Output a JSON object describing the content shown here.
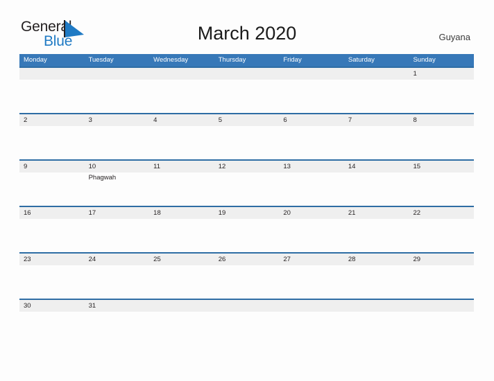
{
  "brand": {
    "name_part1": "General",
    "name_part2": "Blue",
    "color_dark": "#231f20",
    "color_blue": "#1f7ac4",
    "flag_icon": "blue-flag-triangle-icon"
  },
  "header": {
    "title": "March 2020",
    "country": "Guyana"
  },
  "theme": {
    "header_blue": "#3778b8",
    "divider_blue": "#2e6da4",
    "band_gray": "#efefef",
    "page_bg": "#fdfdfd",
    "text": "#231f20"
  },
  "calendar": {
    "month": "March",
    "year": "2020",
    "weekday_headers": [
      "Monday",
      "Tuesday",
      "Wednesday",
      "Thursday",
      "Friday",
      "Saturday",
      "Sunday"
    ],
    "weeks": [
      {
        "cells": [
          {
            "day": "",
            "event": ""
          },
          {
            "day": "",
            "event": ""
          },
          {
            "day": "",
            "event": ""
          },
          {
            "day": "",
            "event": ""
          },
          {
            "day": "",
            "event": ""
          },
          {
            "day": "",
            "event": ""
          },
          {
            "day": "1",
            "event": ""
          }
        ]
      },
      {
        "cells": [
          {
            "day": "2",
            "event": ""
          },
          {
            "day": "3",
            "event": ""
          },
          {
            "day": "4",
            "event": ""
          },
          {
            "day": "5",
            "event": ""
          },
          {
            "day": "6",
            "event": ""
          },
          {
            "day": "7",
            "event": ""
          },
          {
            "day": "8",
            "event": ""
          }
        ]
      },
      {
        "cells": [
          {
            "day": "9",
            "event": ""
          },
          {
            "day": "10",
            "event": "Phagwah"
          },
          {
            "day": "11",
            "event": ""
          },
          {
            "day": "12",
            "event": ""
          },
          {
            "day": "13",
            "event": ""
          },
          {
            "day": "14",
            "event": ""
          },
          {
            "day": "15",
            "event": ""
          }
        ]
      },
      {
        "cells": [
          {
            "day": "16",
            "event": ""
          },
          {
            "day": "17",
            "event": ""
          },
          {
            "day": "18",
            "event": ""
          },
          {
            "day": "19",
            "event": ""
          },
          {
            "day": "20",
            "event": ""
          },
          {
            "day": "21",
            "event": ""
          },
          {
            "day": "22",
            "event": ""
          }
        ]
      },
      {
        "cells": [
          {
            "day": "23",
            "event": ""
          },
          {
            "day": "24",
            "event": ""
          },
          {
            "day": "25",
            "event": ""
          },
          {
            "day": "26",
            "event": ""
          },
          {
            "day": "27",
            "event": ""
          },
          {
            "day": "28",
            "event": ""
          },
          {
            "day": "29",
            "event": ""
          }
        ]
      },
      {
        "cells": [
          {
            "day": "30",
            "event": ""
          },
          {
            "day": "31",
            "event": ""
          },
          {
            "day": "",
            "event": ""
          },
          {
            "day": "",
            "event": ""
          },
          {
            "day": "",
            "event": ""
          },
          {
            "day": "",
            "event": ""
          },
          {
            "day": "",
            "event": ""
          }
        ]
      }
    ],
    "holidays": [
      {
        "date": "10",
        "name": "Phagwah"
      }
    ]
  }
}
